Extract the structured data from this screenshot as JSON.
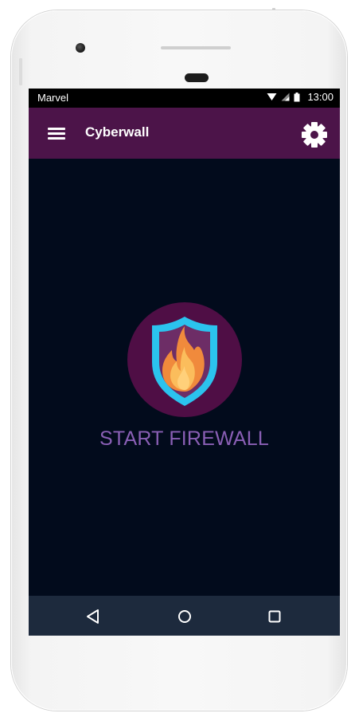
{
  "device": {
    "frame": "phone"
  },
  "status_bar": {
    "carrier": "Marvel",
    "time": "13:00",
    "icons": [
      "wifi-icon",
      "signal-icon",
      "battery-icon"
    ]
  },
  "app_bar": {
    "title": "Cyberwall",
    "menu_icon": "menu-icon",
    "settings_icon": "settings-icon",
    "background": "#4c1449"
  },
  "main": {
    "button_label": "START FIREWALL",
    "button_icon": "firewall-shield-icon",
    "label_color": "#8a5fb5",
    "background": "#020b1c"
  },
  "nav_bar": {
    "buttons": [
      "back-icon",
      "home-icon",
      "recents-icon"
    ]
  }
}
